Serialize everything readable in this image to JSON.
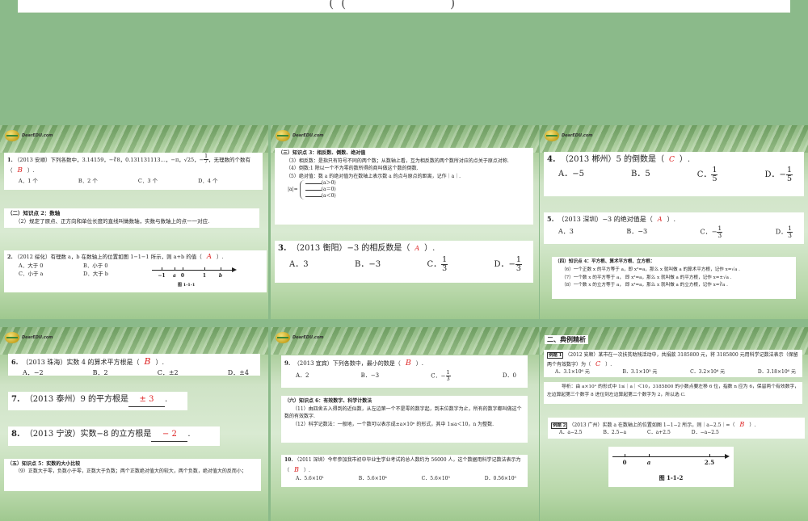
{
  "top": {
    "brace_left": "(",
    "brace_mid": "(",
    "brace_right": ")"
  },
  "logo": "DearEDU.com",
  "s1": {
    "q1": {
      "num": "1.",
      "text": "（2013 安顺）下列各数中，3.14159，−∛8，0.131131113…，−π，√25，",
      "frac": [
        "1",
        "7"
      ],
      "text2": "，无理数的个数有（",
      "answer": "B",
      "tail": "）.",
      "options": [
        "A．1 个",
        "B．2 个",
        "C．3 个",
        "D．4 个"
      ]
    },
    "k2": {
      "title": "（二）知识点 2：数轴",
      "body": "（2）规定了原点、正方向和单位长度的直线叫做数轴，实数与数轴上的点一一对应."
    },
    "q2": {
      "num": "2.",
      "text": "（2012 绥化）有理数 a，b 在数轴上的位置如图 1−1−1 所示，则 a+b 的值（",
      "answer": "A",
      "tail": "）.",
      "options": [
        "A．大于 0",
        "B．小于 0",
        "C．小于 a",
        "D．大于 b"
      ],
      "axis": [
        "−1",
        "a",
        "0",
        "1",
        "b"
      ],
      "caption": "图 1-1-1"
    }
  },
  "s2": {
    "k3": {
      "title": "（三）知识点 3：相反数、倒数、绝对值",
      "l3": "（3）相反数：是指只有符号不同的两个数；从数轴上看，互为相反数的两个数所对应的点关于原点对称.",
      "l4": "（4）倒数:1 除以一个不为零的数所得的商叫做这个数的倒数.",
      "l5": "（5）绝对值：数 a 的绝对值为在数轴上表示数 a 的点与原点的距离，记作｜a｜.",
      "abs": "|a|=",
      "cases": [
        "(a＞0)",
        "(a＝0)",
        "(a＜0)"
      ]
    },
    "q3": {
      "num": "3.",
      "text": "（2013 衡阳）−3 的相反数是（",
      "answer": "A",
      "tail": "）.",
      "options": [
        "A．3",
        "B．−3",
        "C．",
        "D．−"
      ],
      "frac": [
        "1",
        "3"
      ]
    }
  },
  "s3": {
    "q4": {
      "num": "4.",
      "text": "（2013 郴州）5 的倒数是（",
      "answer": "C",
      "tail": "）.",
      "options": [
        "A．−5",
        "B．5",
        "C．",
        "D．−"
      ],
      "frac": [
        "1",
        "5"
      ]
    },
    "q5": {
      "num": "5.",
      "text": "（2013 深圳）−3 的绝对值是（",
      "answer": "A",
      "tail": "）.",
      "options": [
        "A．3",
        "B．−3",
        "C．−",
        "D．"
      ],
      "frac": [
        "1",
        "3"
      ]
    },
    "k4": {
      "title": "（四）知识点 4：平方根、算术平方根、立方根：",
      "l6": "（6）一个正数 x 的平方等于 a，即 x²=a，那么 x 就叫做 a 的算术平方根，记作 x=√a .",
      "l7": "（7）一个数 x 的平方等于 a， 即 x²=a，那么 x 就叫做 a 的平方根，记作 x=±√a .",
      "l8": "（8）一个数 x 的立方等于 a， 即 x³=a，那么 x 就叫做 a 的立方根，记作 x=∛a ."
    }
  },
  "s4": {
    "q6": {
      "num": "6.",
      "text": "（2013 珠海）实数 4 的算术平方根是（",
      "answer": "B",
      "tail": "）.",
      "options": [
        "A．−2",
        "B．2",
        "C．±2",
        "D．±4"
      ]
    },
    "q7": {
      "num": "7.",
      "text": "（2013 泰州）9 的平方根是",
      "answer": "± 3",
      "tail": "."
    },
    "q8": {
      "num": "8.",
      "text": "（2013 宁波）实数−8 的立方根是",
      "answer": "− 2",
      "tail": "."
    },
    "k5": {
      "title": "（五）知识点 5：实数的大小比较",
      "l9": "（9）正数大于零，负数小于零，正数大于负数；两个正数绝对值大的较大，两个负数，绝对值大的反而小；"
    }
  },
  "s5": {
    "q9": {
      "num": "9.",
      "text": "（2013 宜宾）下列各数中，最小的数是（",
      "answer": "B",
      "tail": "）.",
      "options": [
        "A．2",
        "B．−3",
        "C．−",
        "D．0"
      ],
      "frac": [
        "1",
        "3"
      ]
    },
    "k6": {
      "title": "（六）知识点 6：有效数字、科学计数法",
      "l11": "（11）由四舍五入得到的近似数，从左边第一个不是零的数字起，到末位数字为止，所有的数字都叫做这个数的有效数字.",
      "l12": "（12）科学记数法：一般地，一个数可以表示成±a×10ⁿ 的形式，其中 1≤a＜10，n 为整数."
    },
    "q10": {
      "num": "10.",
      "text": "（2011 深圳）今年参加我市初中毕业生学业考试的总人数约为 56000 人，这个数据用科学记数法表示为（",
      "answer": "B",
      "tail": "）.",
      "options": [
        "A．5.6×10¹",
        "B．5.6×10⁴",
        "C．5.6×10⁵",
        "D．0.56×10⁵"
      ]
    }
  },
  "s6": {
    "title": "二、典例精析",
    "e1": {
      "tag": "例题 1",
      "text": "（2012 安顺）某市在一次扶贫助残活动中，共捐款 3185800 元，将 3185800 元用科学记数法表示（保留两个有效数字）为（",
      "answer": "C",
      "tail": "）.",
      "options": [
        "A．3.1×10⁶ 元",
        "B．3.1×10⁵ 元",
        "C．3.2×10⁶ 元",
        "D．3.18×10⁶ 元"
      ]
    },
    "guide": "导析：由 a×10ⁿ 的形式中 1≤｜a｜＜10，3185800 的小数点要左移 6 位，指数 n 应为 6，保留两个有效数字，左边算起第三个数字 8 进位到左边算起第二个数字为 2，所以选 C.",
    "e2": {
      "tag": "例题 2",
      "text": "（2013 广州）实数 a 在数轴上的位置如图 1−1−2 所示，则｜a−2.5｜=（",
      "answer": "B",
      "tail": "）.",
      "options": [
        "A．a−2.5",
        "B．2.5−a",
        "C．a+2.5",
        "D．−a−2.5"
      ],
      "axis": [
        "0",
        "a",
        "2.5"
      ],
      "caption": "图 1-1-2"
    }
  }
}
